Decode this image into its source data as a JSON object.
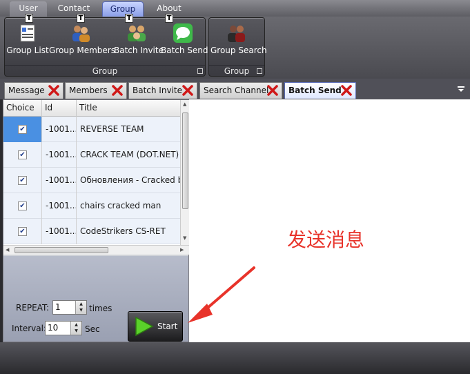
{
  "menu": {
    "tabs": [
      {
        "label": "User"
      },
      {
        "label": "Contact"
      },
      {
        "label": "Group"
      },
      {
        "label": "About"
      }
    ],
    "active": "Group"
  },
  "ribbon": {
    "group1": {
      "footer": "Group",
      "buttons": [
        {
          "label": "Group List",
          "keytip": "T",
          "icon": "list-icon"
        },
        {
          "label": "Group Members",
          "keytip": "T",
          "icon": "members-icon"
        },
        {
          "label": "Batch Invite",
          "keytip": "T",
          "icon": "invite-icon"
        },
        {
          "label": "Batch Send",
          "keytip": "T",
          "icon": "chat-bubble-icon"
        }
      ]
    },
    "group2": {
      "footer": "Group",
      "buttons": [
        {
          "label": "Group Search",
          "icon": "search-people-icon"
        }
      ]
    }
  },
  "doc_tabs": [
    {
      "label": "Message"
    },
    {
      "label": "Members"
    },
    {
      "label": "Batch Invite"
    },
    {
      "label": "Search Channel"
    },
    {
      "label": "Batch Send"
    }
  ],
  "active_doc_tab": "Batch Send",
  "grid": {
    "columns": [
      "Choice",
      "Id",
      "Title"
    ],
    "rows": [
      {
        "checked": true,
        "id": "-1001...",
        "title": "REVERSE TEAM"
      },
      {
        "checked": true,
        "id": "-1001...",
        "title": "CRACK TEAM (DOT.NET)"
      },
      {
        "checked": true,
        "id": "-1001...",
        "title": "Обновления - Cracked by"
      },
      {
        "checked": true,
        "id": "-1001...",
        "title": "chairs cracked man"
      },
      {
        "checked": true,
        "id": "-1001...",
        "title": "CodeStrikers CS-RET"
      }
    ]
  },
  "controls": {
    "repeat_label": "REPEAT:",
    "repeat_value": "1",
    "repeat_unit": "times",
    "interval_label": "Interval:",
    "interval_value": "10",
    "interval_unit": "Sec",
    "start_label": "Start"
  },
  "annotation": {
    "text": "发送消息",
    "color": "#e8332a"
  },
  "colors": {
    "accent": "#4a90e2",
    "annotation_red": "#e8332a"
  }
}
